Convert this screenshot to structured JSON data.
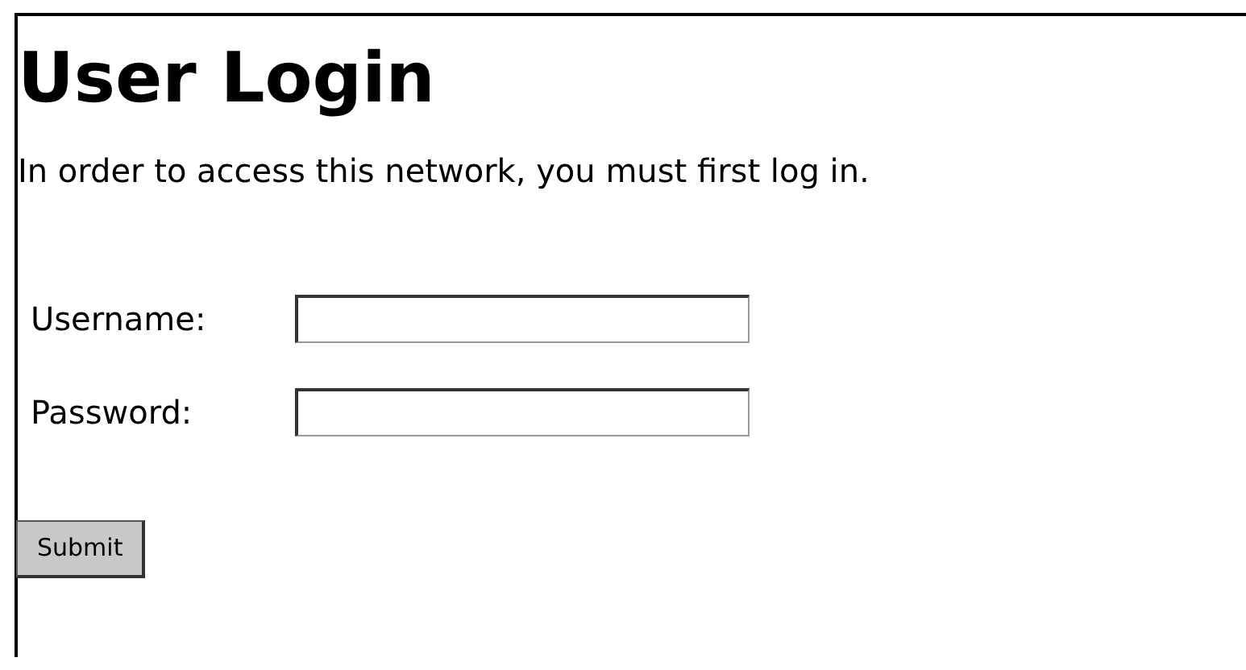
{
  "title": "User Login",
  "intro": "In order to access this network, you must first log in.",
  "fields": [
    {
      "label": "Username:"
    },
    {
      "label": "Password:"
    }
  ],
  "submit": "Submit"
}
